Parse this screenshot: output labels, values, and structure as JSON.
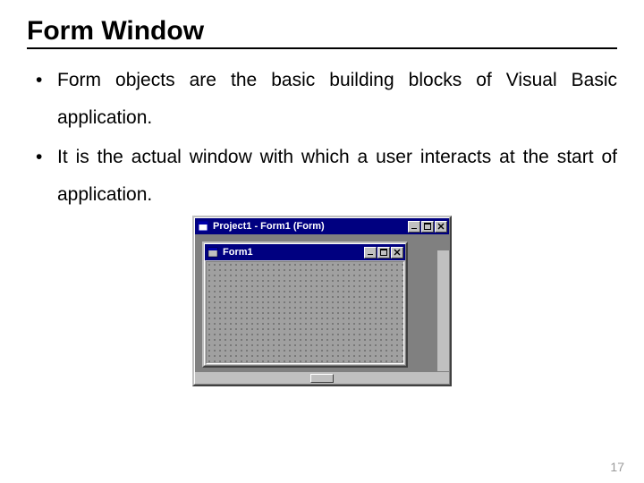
{
  "heading": "Form Window",
  "bullets": [
    "Form objects are the basic building blocks of Visual Basic application.",
    "It is the actual window with which a user interacts at the start of application."
  ],
  "outerWindow": {
    "title": "Project1 - Form1 (Form)"
  },
  "innerWindow": {
    "title": "Form1"
  },
  "pageNumber": "17"
}
